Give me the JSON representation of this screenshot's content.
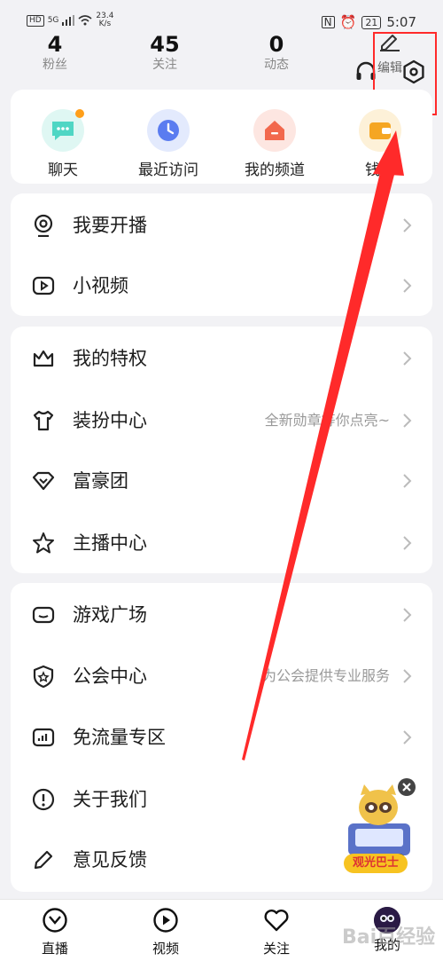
{
  "status_bar": {
    "hd": "HD",
    "signal": "5G",
    "net_speed": "23.4",
    "net_unit": "K/s",
    "battery": "21",
    "time": "5:07"
  },
  "profile_stats": [
    {
      "num": "4",
      "label": "粉丝"
    },
    {
      "num": "45",
      "label": "关注"
    },
    {
      "num": "0",
      "label": "动态"
    }
  ],
  "edit_label": "编辑",
  "quick_actions": [
    {
      "label": "聊天",
      "color": "#4fd6c4",
      "bg": "#dff7f3",
      "icon": "chat-icon"
    },
    {
      "label": "最近访问",
      "color": "#5a7cf0",
      "bg": "#e3eafd",
      "icon": "clock-icon"
    },
    {
      "label": "我的频道",
      "color": "#f2684d",
      "bg": "#fde6e1",
      "icon": "home-icon"
    },
    {
      "label": "钱包",
      "color": "#f5a623",
      "bg": "#fdf1d8",
      "icon": "wallet-icon"
    }
  ],
  "menu_groups": [
    [
      {
        "label": "我要开播",
        "sub": "",
        "icon": "webcam-icon"
      },
      {
        "label": "小视频",
        "sub": "",
        "icon": "video-icon"
      }
    ],
    [
      {
        "label": "我的特权",
        "sub": "",
        "icon": "crown-icon"
      },
      {
        "label": "装扮中心",
        "sub": "全新勋章等你点亮~",
        "icon": "shirt-icon"
      },
      {
        "label": "富豪团",
        "sub": "",
        "icon": "diamond-icon"
      },
      {
        "label": "主播中心",
        "sub": "",
        "icon": "star-icon"
      }
    ],
    [
      {
        "label": "游戏广场",
        "sub": "",
        "icon": "gamepad-icon"
      },
      {
        "label": "公会中心",
        "sub": "为公会提供专业服务",
        "icon": "shield-icon"
      },
      {
        "label": "免流量专区",
        "sub": "",
        "icon": "signal-icon"
      },
      {
        "label": "关于我们",
        "sub": "",
        "icon": "info-icon"
      },
      {
        "label": "意见反馈",
        "sub": "",
        "icon": "pencil-icon"
      }
    ]
  ],
  "ad": {
    "label": "观光巴士"
  },
  "tabs": [
    {
      "label": "直播",
      "icon": "live-icon"
    },
    {
      "label": "视频",
      "icon": "play-icon"
    },
    {
      "label": "关注",
      "icon": "heart-icon"
    },
    {
      "label": "我的",
      "icon": "avatar"
    }
  ],
  "watermark": "Bai百经验",
  "colors": {
    "accent": "#ff2a2a",
    "text": "#222222",
    "muted": "#999999"
  }
}
